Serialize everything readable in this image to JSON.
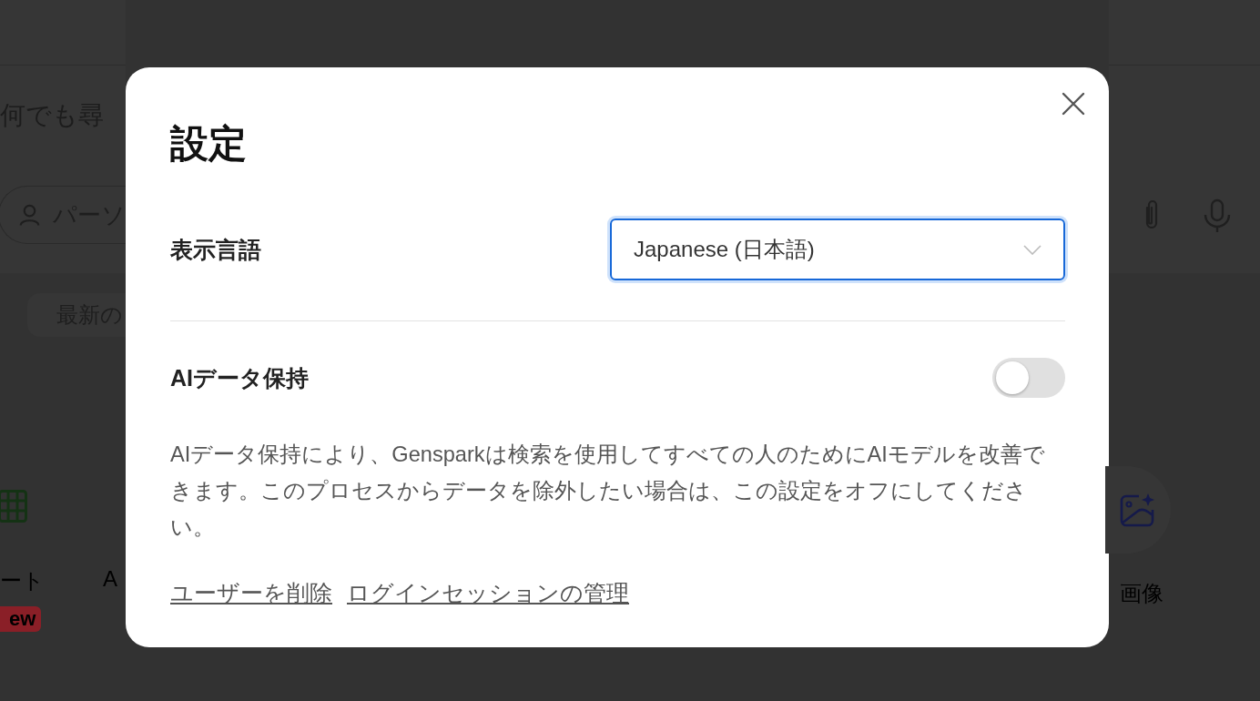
{
  "background": {
    "heading": "何でも尋",
    "input_text": "パーソ",
    "chip": "最新の",
    "left_tool": {
      "label": "ート",
      "badge": "ew"
    },
    "middle_tool": {
      "label": "A"
    },
    "right_tool": {
      "label": "画像"
    }
  },
  "dialog": {
    "title": "設定",
    "settings": [
      {
        "kind": "select",
        "label": "表示言語",
        "value": "Japanese (日本語)"
      },
      {
        "kind": "toggle",
        "label": "AIデータ保持",
        "on": false,
        "description": "AIデータ保持により、Gensparkは検索を使用してすべての人のためにAIモデルを改善できます。このプロセスからデータを除外したい場合は、この設定をオフにしてください。"
      }
    ],
    "links": [
      "ユーザーを削除",
      "ログインセッションの管理"
    ]
  }
}
